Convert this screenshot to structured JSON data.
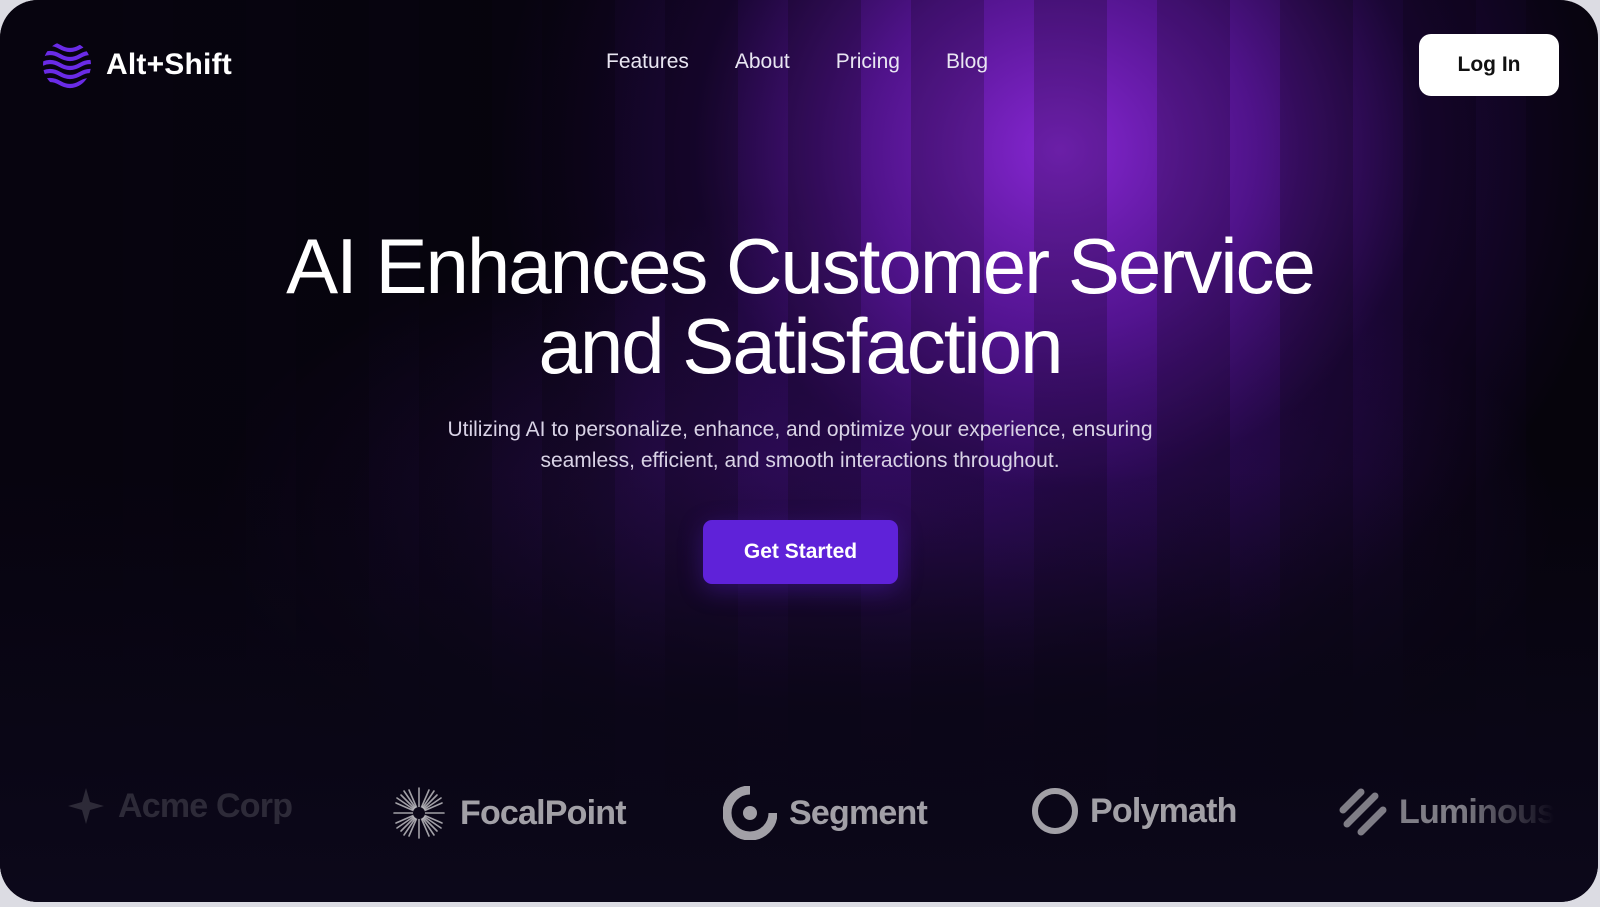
{
  "brand": {
    "name": "Alt+Shift",
    "logo_icon": "wave-sphere-icon",
    "accent": "#5f22d9"
  },
  "nav": {
    "links": [
      "Features",
      "About",
      "Pricing",
      "Blog"
    ],
    "login_label": "Log In"
  },
  "hero": {
    "title_line1": "AI Enhances Customer Service",
    "title_line2": "and Satisfaction",
    "subtitle_line1": "Utilizing AI to personalize, enhance, and optimize your experience, ensuring",
    "subtitle_line2": "seamless, efficient, and smooth interactions throughout.",
    "cta_label": "Get Started"
  },
  "logos": [
    {
      "name": "Acme Corp",
      "icon": "sparkle-icon"
    },
    {
      "name": "FocalPoint",
      "icon": "starburst-icon"
    },
    {
      "name": "Segment",
      "icon": "segment-ring-icon"
    },
    {
      "name": "Polymath",
      "icon": "ring-icon"
    },
    {
      "name": "Luminous",
      "icon": "diagonal-stripes-icon"
    }
  ],
  "colors": {
    "background": "#07040f",
    "glow": "#8c28dc",
    "cta": "#5f22d9",
    "login_bg": "#ffffff"
  }
}
